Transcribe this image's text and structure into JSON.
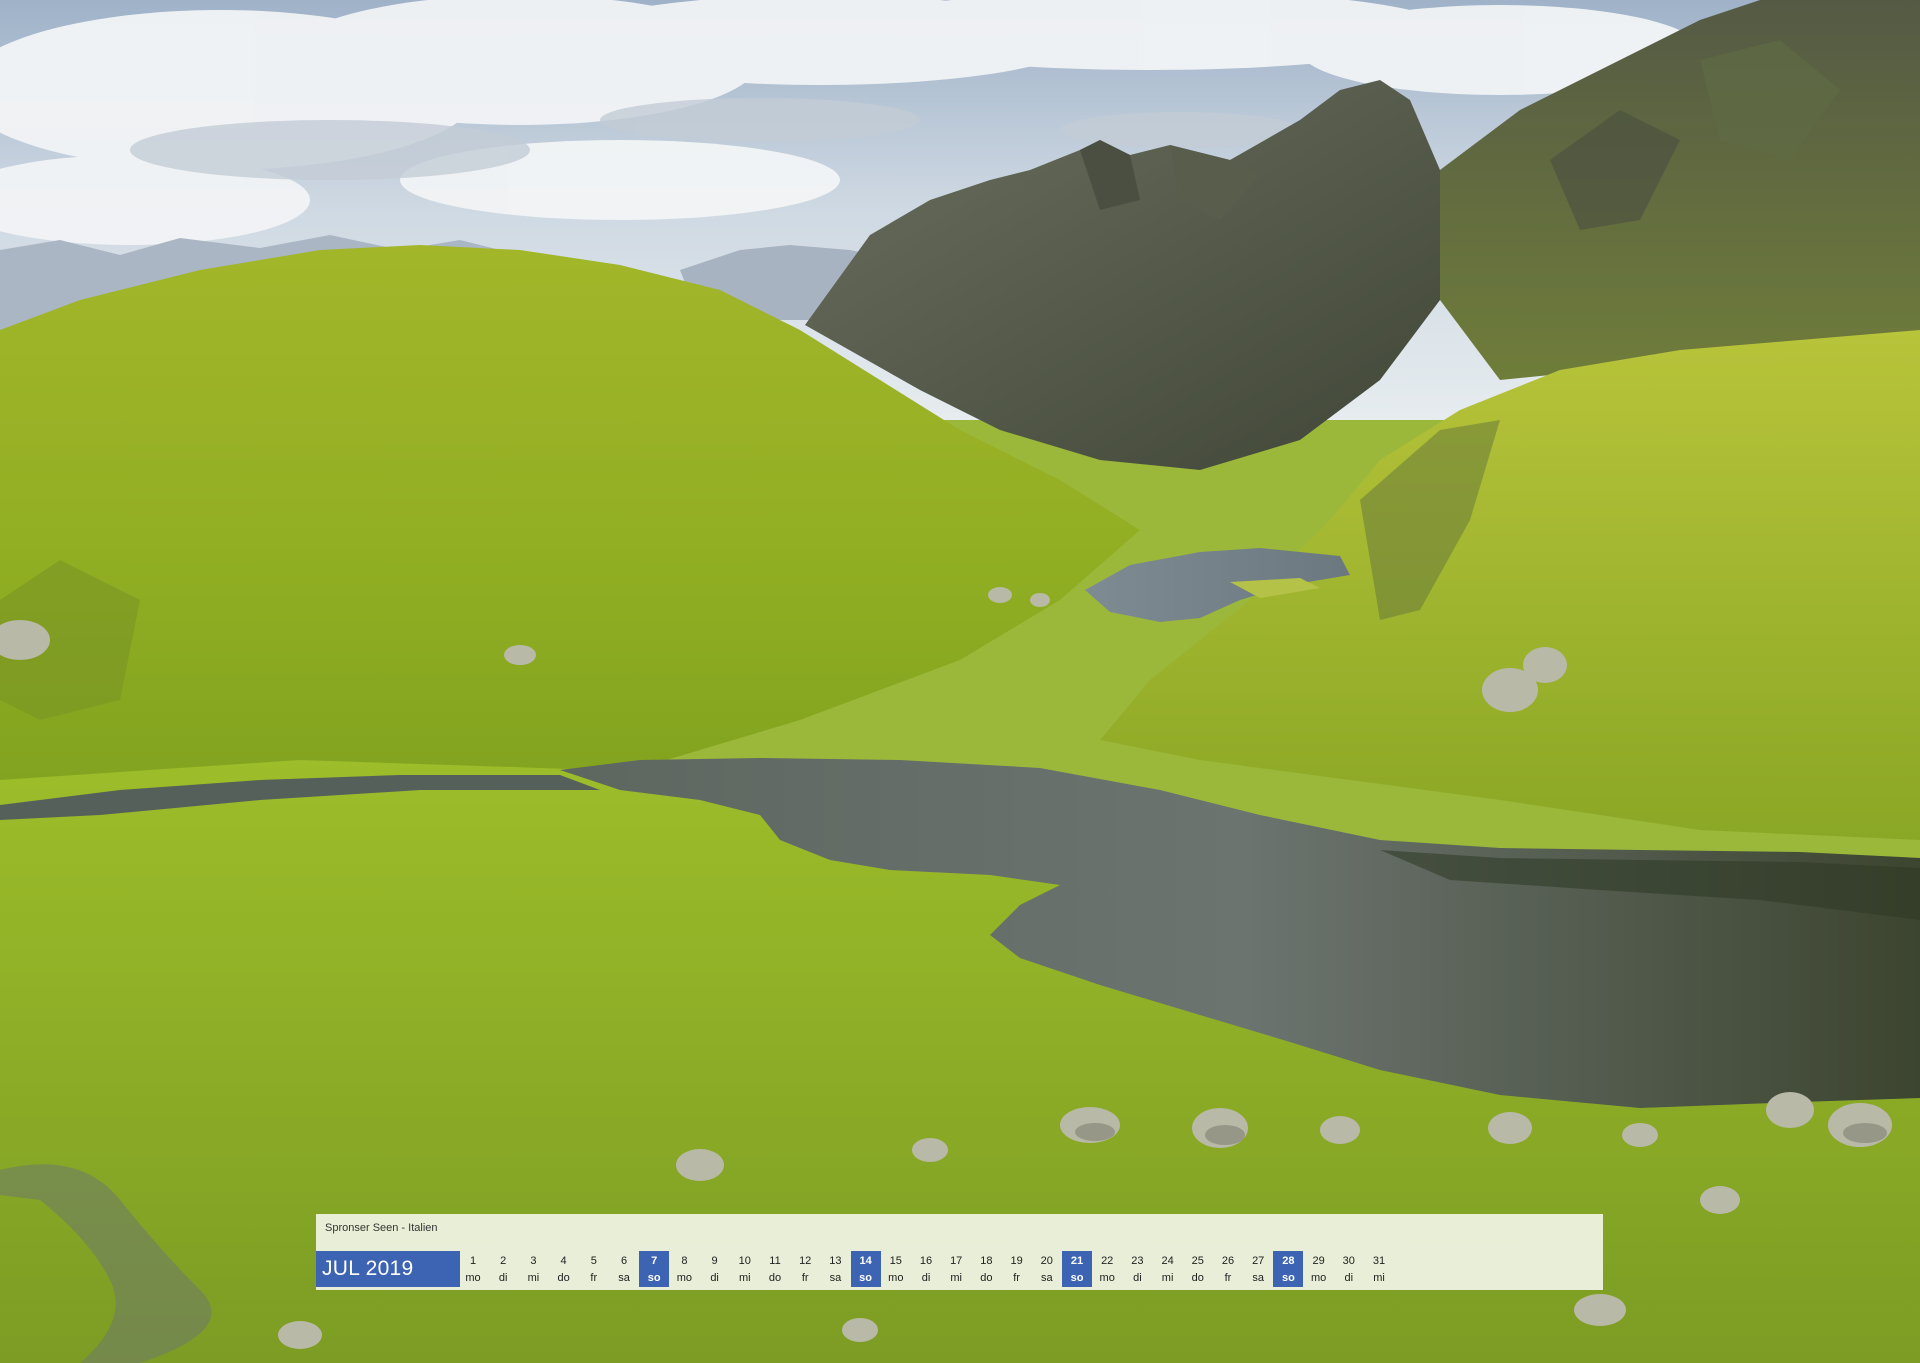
{
  "calendar": {
    "caption": "Spronser Seen - Italien",
    "month_label": "JUL 2019",
    "accent_color": "#3d63b3",
    "days": [
      {
        "n": "1",
        "wd": "mo"
      },
      {
        "n": "2",
        "wd": "di"
      },
      {
        "n": "3",
        "wd": "mi"
      },
      {
        "n": "4",
        "wd": "do"
      },
      {
        "n": "5",
        "wd": "fr"
      },
      {
        "n": "6",
        "wd": "sa"
      },
      {
        "n": "7",
        "wd": "so"
      },
      {
        "n": "8",
        "wd": "mo"
      },
      {
        "n": "9",
        "wd": "di"
      },
      {
        "n": "10",
        "wd": "mi"
      },
      {
        "n": "11",
        "wd": "do"
      },
      {
        "n": "12",
        "wd": "fr"
      },
      {
        "n": "13",
        "wd": "sa"
      },
      {
        "n": "14",
        "wd": "so"
      },
      {
        "n": "15",
        "wd": "mo"
      },
      {
        "n": "16",
        "wd": "di"
      },
      {
        "n": "17",
        "wd": "mi"
      },
      {
        "n": "18",
        "wd": "do"
      },
      {
        "n": "19",
        "wd": "fr"
      },
      {
        "n": "20",
        "wd": "sa"
      },
      {
        "n": "21",
        "wd": "so"
      },
      {
        "n": "22",
        "wd": "mo"
      },
      {
        "n": "23",
        "wd": "di"
      },
      {
        "n": "24",
        "wd": "mi"
      },
      {
        "n": "25",
        "wd": "do"
      },
      {
        "n": "26",
        "wd": "fr"
      },
      {
        "n": "27",
        "wd": "sa"
      },
      {
        "n": "28",
        "wd": "so"
      },
      {
        "n": "29",
        "wd": "mo"
      },
      {
        "n": "30",
        "wd": "di"
      },
      {
        "n": "31",
        "wd": "mi"
      }
    ]
  }
}
